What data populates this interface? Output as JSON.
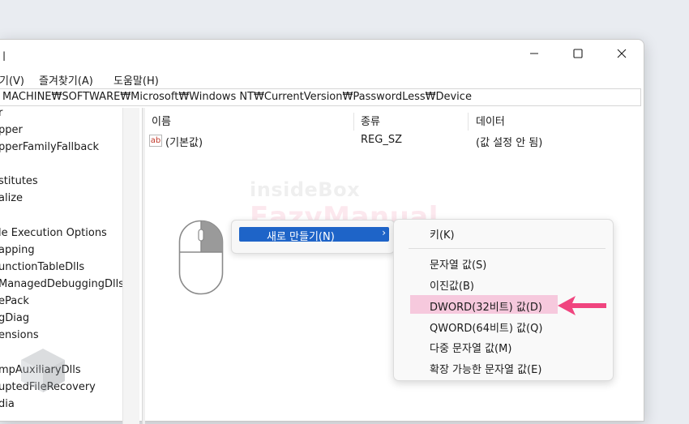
{
  "window": {
    "title": "ㅣ",
    "minimize_icon": "minimize-icon",
    "maximize_icon": "maximize-icon",
    "close_icon": "close-icon"
  },
  "menubar": {
    "items": [
      "기(V)",
      "즐겨찾기(A)",
      "도움말(H)"
    ]
  },
  "address": "MACHINE₩SOFTWARE₩Microsoft₩Windows NT₩CurrentVersion₩PasswordLess₩Device",
  "tree": {
    "items": [
      "r",
      "pper",
      "pperFamilyFallback",
      "",
      "stitutes",
      "alize",
      "",
      "le Execution Options",
      "apping",
      "unctionTableDlls",
      "ManagedDebuggingDlls",
      "ePack",
      "gDiag",
      "ensions",
      "",
      "mpAuxiliaryDlls",
      "uptedFileRecovery",
      "dia"
    ]
  },
  "list": {
    "columns": [
      "이름",
      "종류",
      "데이터"
    ],
    "rows": [
      {
        "name": "(기본값)",
        "type": "REG_SZ",
        "data": "(값 설정 안 됨)",
        "icon": "ab-icon",
        "icon_text": "ab"
      }
    ]
  },
  "watermark": {
    "line1": "insideBox",
    "line2": "EazyManual"
  },
  "context_menu": {
    "new_item": "새로 만들기(N)",
    "submenu_arrow": "›"
  },
  "submenu": {
    "items": [
      "키(K)",
      "문자열 값(S)",
      "이진값(B)",
      "DWORD(32비트) 값(D)",
      "QWORD(64비트) 값(Q)",
      "다중 문자열 값(M)",
      "확장 가능한 문자열 값(E)"
    ],
    "highlighted_item": "DWORD(32비트) 값(D)"
  },
  "colors": {
    "accent": "#1e64c8",
    "highlight": "#f6c9dd",
    "arrow": "#f0457f"
  }
}
